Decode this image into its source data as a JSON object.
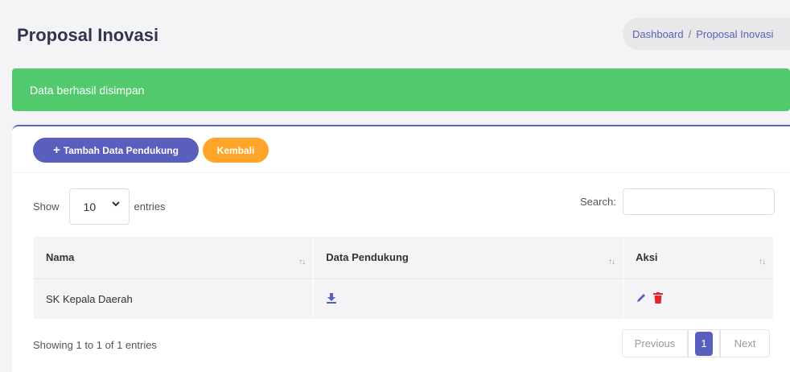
{
  "header": {
    "title": "Proposal Inovasi",
    "breadcrumb": {
      "home": "Dashboard",
      "separator": "/",
      "current": "Proposal Inovasi"
    }
  },
  "alert": {
    "message": "Data berhasil disimpan",
    "color": "#53c96d"
  },
  "toolbar": {
    "add_icon": "+",
    "add_label": "Tambah Data Pendukung",
    "back_label": "Kembali"
  },
  "length_control": {
    "show_label": "Show",
    "value": "10",
    "entries_label": "entries"
  },
  "search": {
    "label": "Search:",
    "value": "",
    "placeholder": ""
  },
  "table": {
    "columns": [
      "Nama",
      "Data Pendukung",
      "Aksi"
    ],
    "sort_icon": "↑↓",
    "rows": [
      {
        "nama": "SK Kepala Daerah",
        "data_pendukung_icon": "download-icon",
        "aksi_icons": [
          "pencil-icon",
          "trash-icon"
        ]
      }
    ]
  },
  "footer": {
    "info": "Showing 1 to 1 of 1 entries",
    "pagination": {
      "previous": "Previous",
      "current_page": "1",
      "next": "Next"
    }
  },
  "colors": {
    "primary": "#5a5fbd",
    "warning": "#ffa52a",
    "danger": "#e3242b",
    "success": "#53c96d"
  }
}
